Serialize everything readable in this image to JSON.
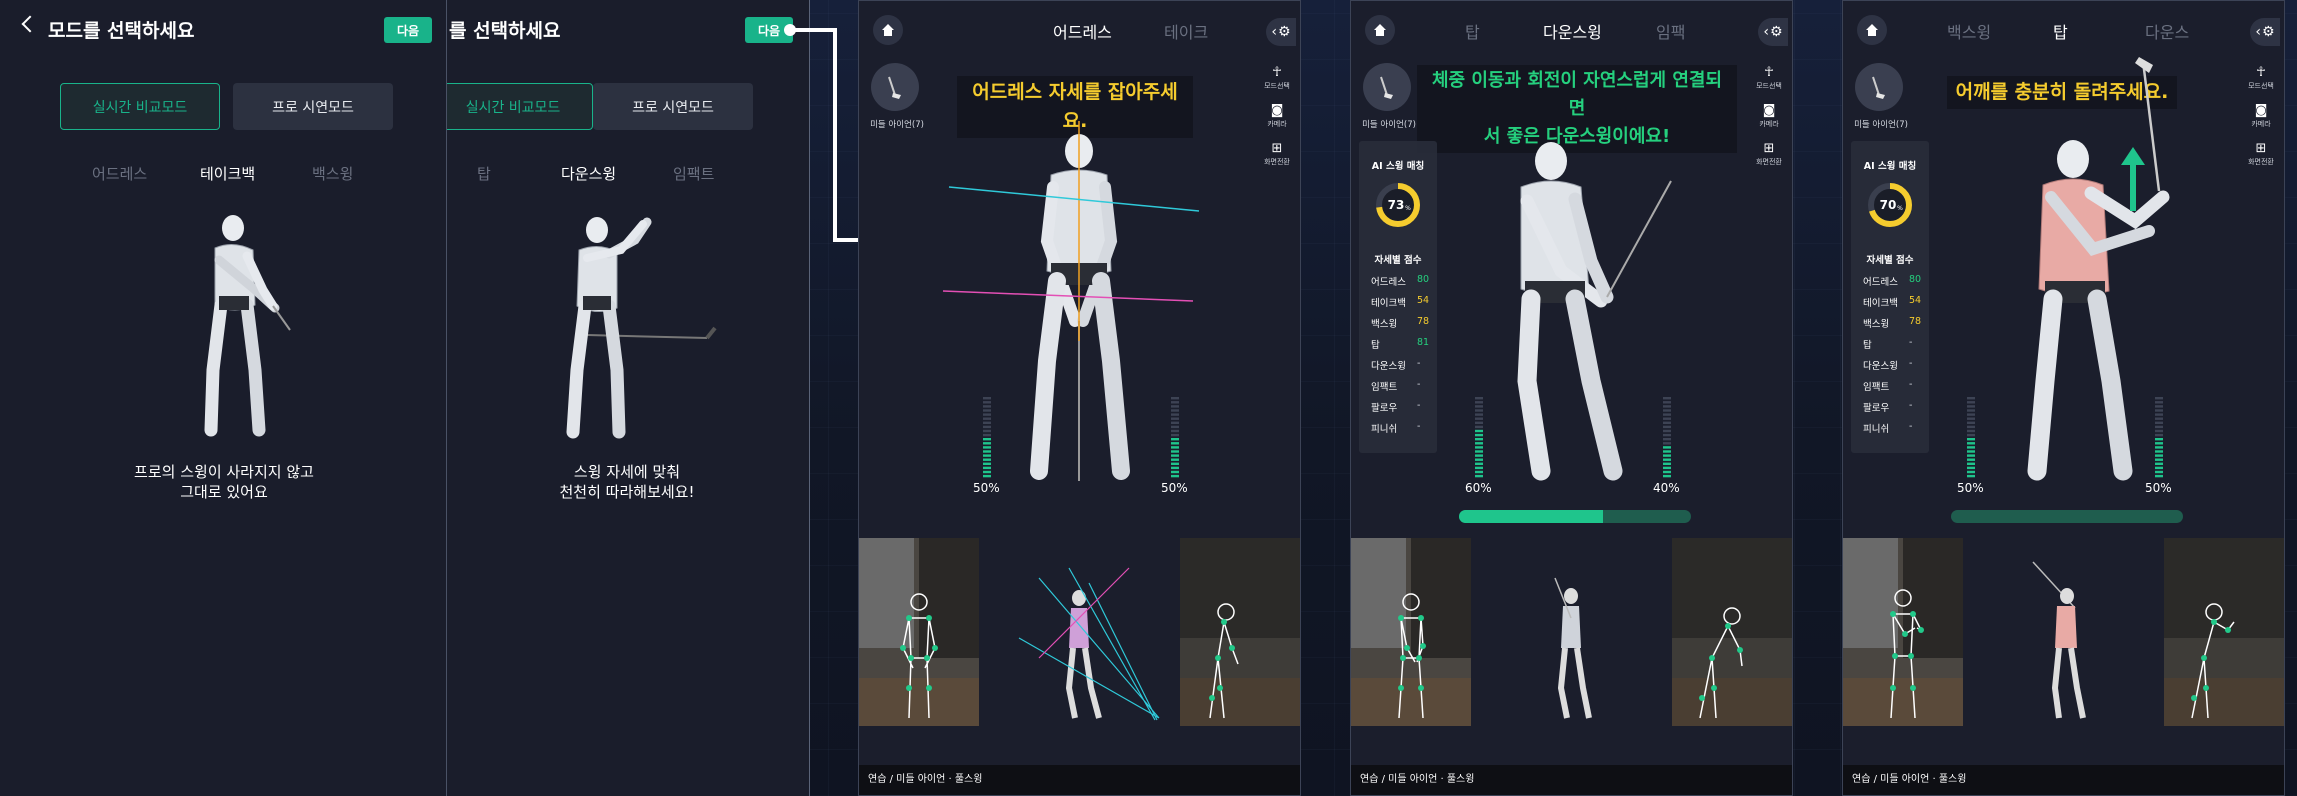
{
  "colors": {
    "accent": "#19b38a",
    "yellow": "#f5cc2e",
    "green": "#25d07e",
    "cyan": "#2fc9d9",
    "magenta": "#e34fb5",
    "orange": "#f0a020"
  },
  "panel1": {
    "title": "모드를 선택하세요",
    "next": "다음",
    "modes": [
      "실시간 비교모드",
      "프로 시연모드"
    ],
    "steps": [
      "어드레스",
      "테이크백",
      "백스윙"
    ],
    "caption": [
      "프로의 스윙이 사라지지 않고",
      "그대로 있어요"
    ]
  },
  "panel2": {
    "title": "를 선택하세요",
    "next": "다음",
    "modes": [
      "실시간 비교모드",
      "프로 시연모드"
    ],
    "steps": [
      "탑",
      "다운스윙",
      "임팩트"
    ],
    "caption": [
      "스윙 자세에 맞춰",
      "천천히 따라해보세요!"
    ]
  },
  "tools": {
    "mode": "모드선택",
    "camera": "카메라",
    "full": "화면전환"
  },
  "club": "미들 아이언(7)",
  "footer": "연습 / 미들 아이언 · 풀스윙",
  "phone1": {
    "tabs": [
      "어드레스",
      "테이크"
    ],
    "guide": "어드레스 자세를 잡아주세요.",
    "left_pct": "50%",
    "right_pct": "50%",
    "left_level": 50,
    "right_level": 50
  },
  "phone2": {
    "tabs": [
      "탑",
      "다운스윙",
      "임팩"
    ],
    "guide": [
      "체중 이동과 회전이 자연스럽게 연결되면",
      "서 좋은 다운스윙이에요!"
    ],
    "left_pct": "60%",
    "right_pct": "40%",
    "left_level": 60,
    "right_level": 40,
    "progress": 0.62,
    "ai_title": "AI 스윙 매칭",
    "ai_value": "73",
    "ai_unit": "%",
    "ai_level": 73,
    "score_title": "자세별 점수",
    "scores": [
      [
        "어드레스",
        "80"
      ],
      [
        "테이크백",
        "54"
      ],
      [
        "백스윙",
        "78"
      ],
      [
        "탑",
        "81"
      ],
      [
        "다운스윙",
        "-"
      ],
      [
        "임팩트",
        "-"
      ],
      [
        "팔로우",
        "-"
      ],
      [
        "피니쉬",
        "-"
      ]
    ]
  },
  "phone3": {
    "tabs": [
      "백스윙",
      "탑",
      "다운스"
    ],
    "guide": "어깨를 충분히 돌려주세요.",
    "left_pct": "50%",
    "right_pct": "50%",
    "left_level": 50,
    "right_level": 50,
    "progress": 0.0,
    "ai_title": "AI 스윙 매칭",
    "ai_value": "70",
    "ai_unit": "%",
    "ai_level": 70,
    "score_title": "자세별 점수",
    "scores": [
      [
        "어드레스",
        "80"
      ],
      [
        "테이크백",
        "54"
      ],
      [
        "백스윙",
        "78"
      ],
      [
        "탑",
        "-"
      ],
      [
        "다운스윙",
        "-"
      ],
      [
        "임팩트",
        "-"
      ],
      [
        "팔로우",
        "-"
      ],
      [
        "피니쉬",
        "-"
      ]
    ]
  }
}
